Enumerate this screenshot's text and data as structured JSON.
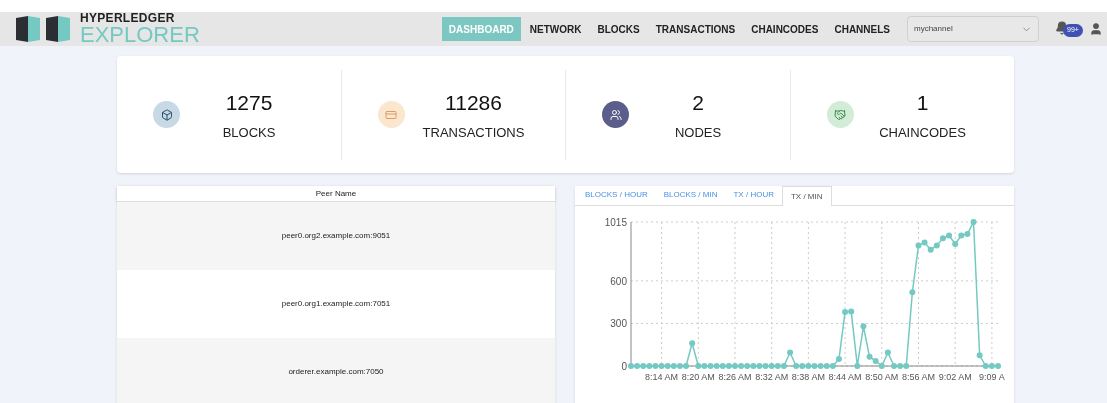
{
  "header": {
    "logo_top": "HYPERLEDGER",
    "logo_bottom": "EXPLORER",
    "nav": [
      {
        "label": "DASHBOARD",
        "selected": true
      },
      {
        "label": "NETWORK",
        "selected": false
      },
      {
        "label": "BLOCKS",
        "selected": false
      },
      {
        "label": "TRANSACTIONS",
        "selected": false
      },
      {
        "label": "CHAINCODES",
        "selected": false
      },
      {
        "label": "CHANNELS",
        "selected": false
      }
    ],
    "channel": "mychannel",
    "notification_count": "99+"
  },
  "stats": [
    {
      "kind": "blocks",
      "value": "1275",
      "label": "BLOCKS"
    },
    {
      "kind": "transactions",
      "value": "11286",
      "label": "TRANSACTIONS"
    },
    {
      "kind": "nodes",
      "value": "2",
      "label": "NODES"
    },
    {
      "kind": "chaincodes",
      "value": "1",
      "label": "CHAINCODES"
    }
  ],
  "peers": {
    "column": "Peer Name",
    "rows": [
      "peer0.org2.example.com:9051",
      "peer0.org1.example.com:7051",
      "orderer.example.com:7050"
    ]
  },
  "chart_tabs": [
    {
      "label": "BLOCKS / HOUR",
      "selected": false
    },
    {
      "label": "BLOCKS / MIN",
      "selected": false
    },
    {
      "label": "TX / HOUR",
      "selected": false
    },
    {
      "label": "TX / MIN",
      "selected": true
    }
  ],
  "chart_data": {
    "type": "line",
    "categories": [
      null,
      null,
      null,
      null,
      null,
      "8:14 AM",
      null,
      null,
      null,
      null,
      null,
      "8:20 AM",
      null,
      null,
      null,
      null,
      null,
      "8:26 AM",
      null,
      null,
      null,
      null,
      null,
      "8:32 AM",
      null,
      null,
      null,
      null,
      null,
      "8:38 AM",
      null,
      null,
      null,
      null,
      null,
      "8:44 AM",
      null,
      null,
      null,
      null,
      null,
      "8:50 AM",
      null,
      null,
      null,
      null,
      null,
      "8:56 AM",
      null,
      null,
      null,
      null,
      null,
      "9:02 AM",
      null,
      null,
      null,
      null,
      null,
      "9:09 A",
      null
    ],
    "grid": true,
    "series": [
      {
        "color": "#74c9c2",
        "marker": true,
        "values": [
          0,
          0,
          0,
          0,
          0,
          0,
          0,
          0,
          0,
          0,
          160,
          0,
          0,
          0,
          0,
          0,
          0,
          0,
          0,
          0,
          0,
          0,
          0,
          0,
          0,
          0,
          95,
          0,
          0,
          0,
          0,
          0,
          0,
          0,
          50,
          380,
          385,
          0,
          280,
          65,
          35,
          0,
          95,
          0,
          0,
          0,
          520,
          850,
          870,
          820,
          850,
          900,
          920,
          860,
          920,
          930,
          1015,
          75,
          0,
          0,
          0
        ]
      }
    ],
    "ylim": [
      0,
      1015
    ],
    "yticks": [
      0,
      300,
      600,
      1015
    ]
  }
}
